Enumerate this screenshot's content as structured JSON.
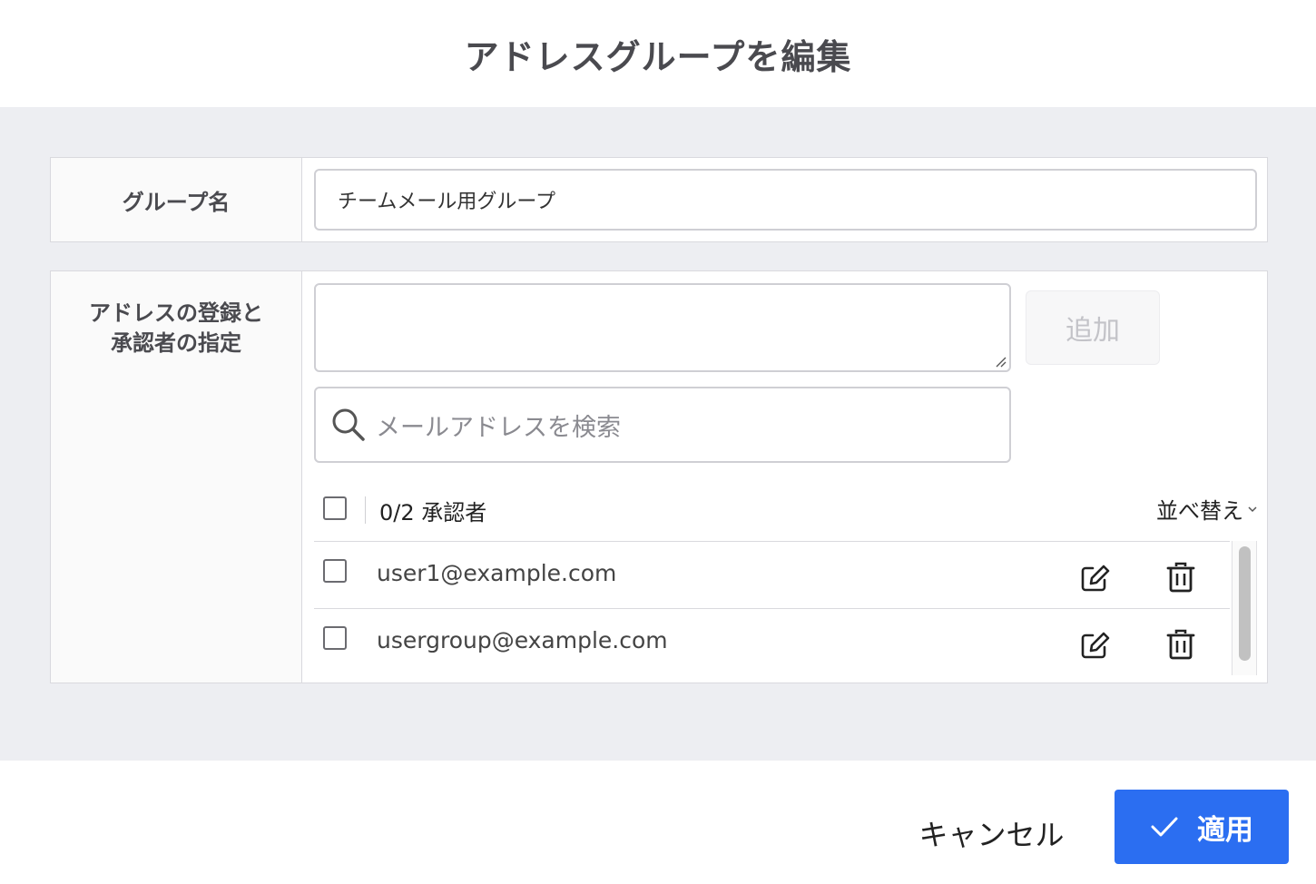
{
  "dialog": {
    "title": "アドレスグループを編集"
  },
  "group_name": {
    "label": "グループ名",
    "value": "チームメール用グループ"
  },
  "addresses": {
    "label_line1": "アドレスの登録と",
    "label_line2": "承認者の指定",
    "textarea_value": "",
    "add_label": "追加",
    "search_placeholder": "メールアドレスを検索",
    "count_label": "0/2 承認者",
    "sort_label": "並べ替え",
    "items": [
      {
        "email": "user1@example.com",
        "checked": false
      },
      {
        "email": "usergroup@example.com",
        "checked": false
      }
    ]
  },
  "footer": {
    "cancel_label": "キャンセル",
    "apply_label": "適用"
  },
  "colors": {
    "primary": "#2b6ef1",
    "background": "#edeef2",
    "border": "#d9d9de"
  }
}
